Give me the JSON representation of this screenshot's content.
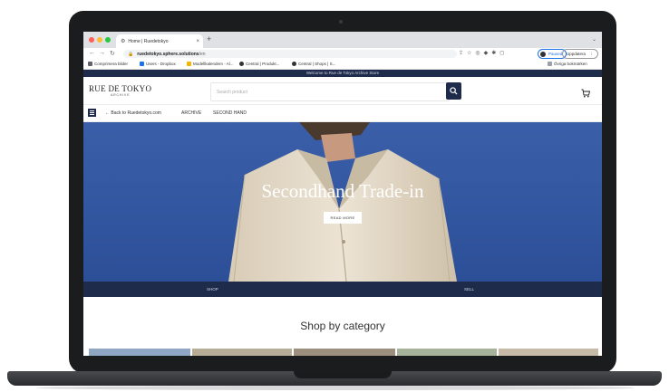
{
  "browser": {
    "tab_title": "Home | Ruedetokyo",
    "new_tab": "+",
    "url_host": "ruedetokyo.sphere.solutions",
    "url_path": "/en",
    "profile_status": "Paused",
    "update_label": "Uppdatera"
  },
  "bookmarks": {
    "items": [
      {
        "label": "Comprimera bilder",
        "color": "#5f6368"
      },
      {
        "label": "Users - Dropbox",
        "color": "#1a73e8"
      },
      {
        "label": "Modellkalendern - Al...",
        "color": "#f4b400"
      },
      {
        "label": "Central | Produkt...",
        "color": "#333333"
      },
      {
        "label": "Central | Shops | S...",
        "color": "#333333"
      }
    ],
    "other": "Övriga bokmärken"
  },
  "site": {
    "promo": "Welcome to Rue de Tokyo Archive Store",
    "logo_main": "RUE DE TOKYO",
    "logo_sub": "ARCHIVE",
    "search_placeholder": "Search product",
    "subnav": {
      "back": "← Back to Ruedetokyo.com",
      "archive": "ARCHIVE",
      "second_hand": "SECOND HAND"
    },
    "hero": {
      "title": "Secondhand Trade-in",
      "button": "READ MORE"
    },
    "tabs": {
      "shop": "SHOP",
      "sell": "SELL"
    },
    "category_title": "Shop by category"
  },
  "colors": {
    "navy": "#1f2b4b",
    "hero_sky": "#2f56a3",
    "jacket": "#e6dccb"
  }
}
